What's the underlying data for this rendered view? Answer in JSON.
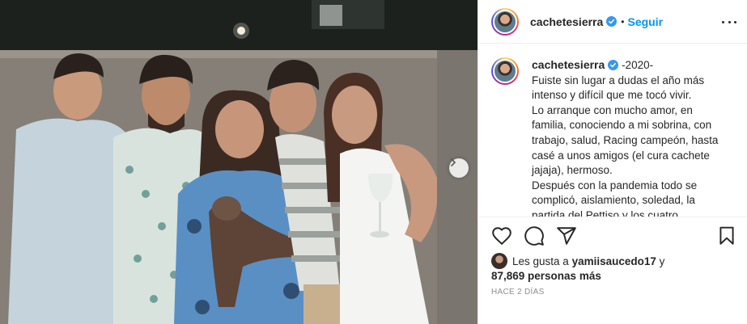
{
  "post": {
    "username": "cachetesierra",
    "follow_label": "Seguir",
    "separator": "•",
    "caption_lines": [
      "-2020-",
      "Fuiste sin lugar a dudas el año más",
      "intenso y difícil que me tocó vivir.",
      "Lo arranque con mucho amor, en",
      "familia, conociendo a mi sobrina, con",
      "trabajo, salud, Racing campeón, hasta",
      "casé a unos amigos (el cura cachete",
      "jajaja), hermoso.",
      "Después con la pandemia todo se",
      "complicó, aislamiento, soledad, la",
      "partida del Pettiso y los cuatro"
    ],
    "likes_prefix": "Les gusta a",
    "likes_user": "yamiisaucedo17",
    "likes_conjunction": "y",
    "likes_count": "87,869 personas más",
    "time_ago": "HACE 2 DÍAS"
  },
  "icons": {
    "verified": "verified-badge-icon",
    "more": "more-options-icon",
    "like": "heart-icon",
    "comment": "comment-icon",
    "share": "share-icon",
    "save": "bookmark-icon",
    "next": "chevron-right-icon"
  },
  "colors": {
    "accent": "#0095f6",
    "text": "#262626",
    "muted": "#8e8e8e",
    "divider": "#efefef"
  }
}
